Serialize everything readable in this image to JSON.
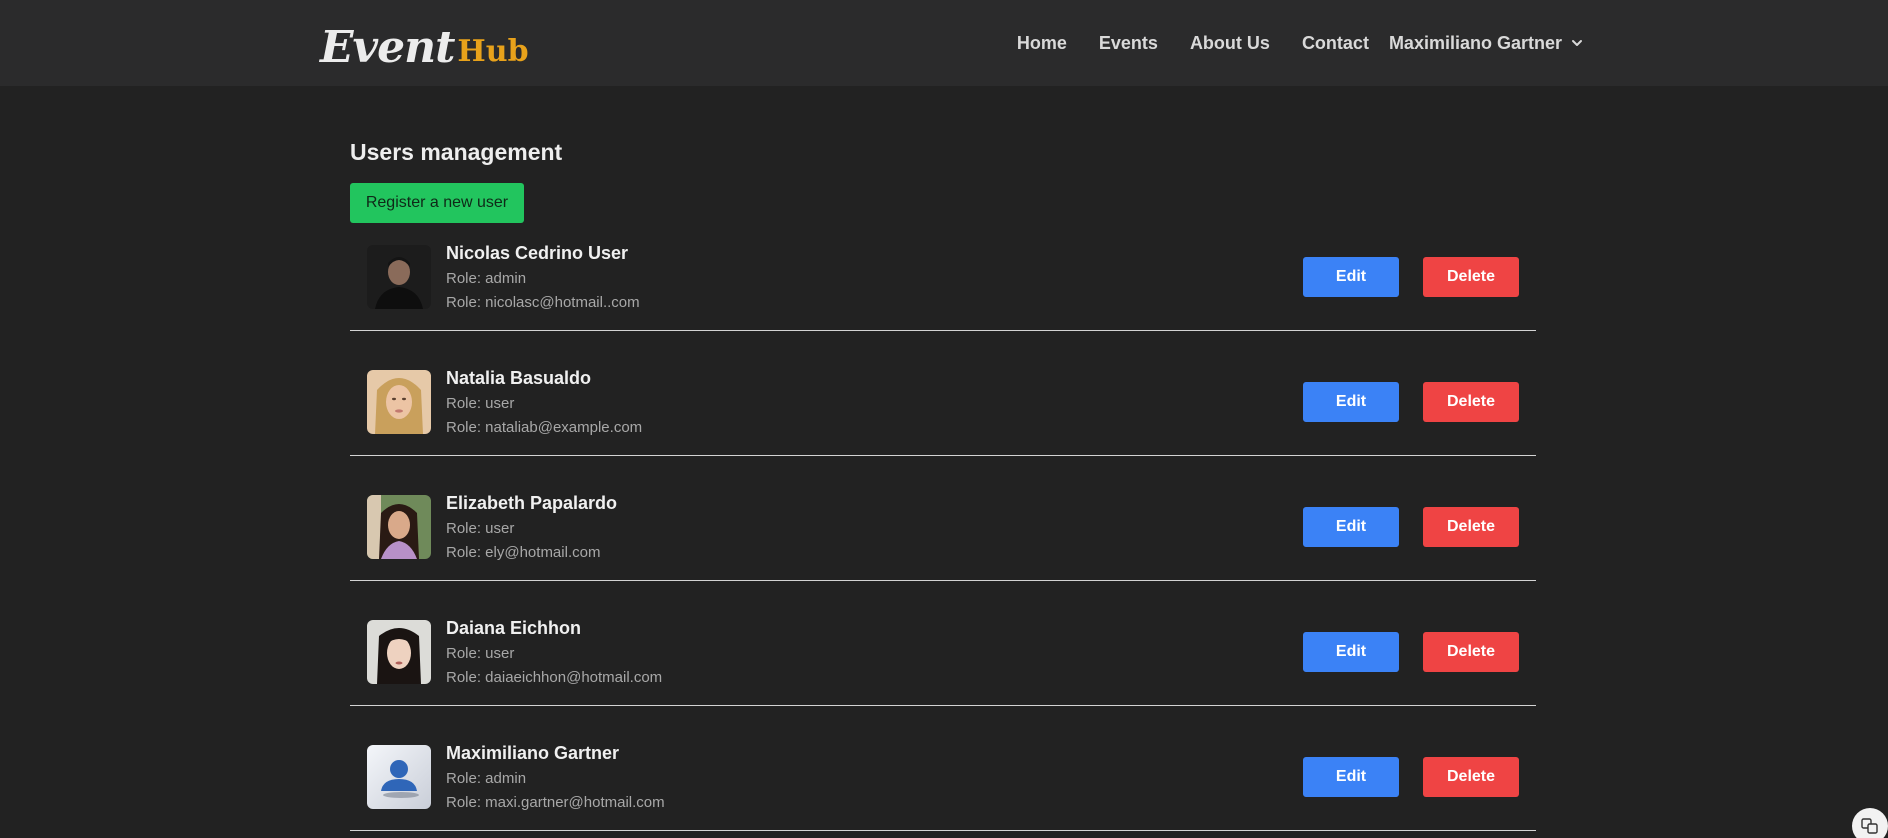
{
  "nav": {
    "logo": {
      "part1": "Event",
      "part2": "Hub"
    },
    "links": [
      "Home",
      "Events",
      "About Us",
      "Contact"
    ],
    "user_menu": "Maximiliano Gartner"
  },
  "main": {
    "title": "Users management",
    "register_label": "Register a new user",
    "users": [
      {
        "name": "Nicolas Cedrino User",
        "role": "Role: admin",
        "email": "Role: nicolasc@hotmail..com",
        "edit": "Edit",
        "delete": "Delete"
      },
      {
        "name": "Natalia Basualdo",
        "role": "Role: user",
        "email": "Role: nataliab@example.com",
        "edit": "Edit",
        "delete": "Delete"
      },
      {
        "name": "Elizabeth Papalardo",
        "role": "Role: user",
        "email": "Role: ely@hotmail.com",
        "edit": "Edit",
        "delete": "Delete"
      },
      {
        "name": "Daiana Eichhon",
        "role": "Role: user",
        "email": "Role: daiaeichhon@hotmail.com",
        "edit": "Edit",
        "delete": "Delete"
      },
      {
        "name": "Maximiliano Gartner",
        "role": "Role: admin",
        "email": "Role: maxi.gartner@hotmail.com",
        "edit": "Edit",
        "delete": "Delete"
      }
    ]
  },
  "colors": {
    "background": "#222222",
    "navbar": "#2b2b2c",
    "register": "#22c55e",
    "edit": "#3b82f6",
    "delete": "#ef4444",
    "logo_accent": "#e8a21b"
  },
  "icons": {
    "user_menu": "chevron-down-icon",
    "avatar_default": "default-user-icon",
    "floating": "translate-icon"
  }
}
